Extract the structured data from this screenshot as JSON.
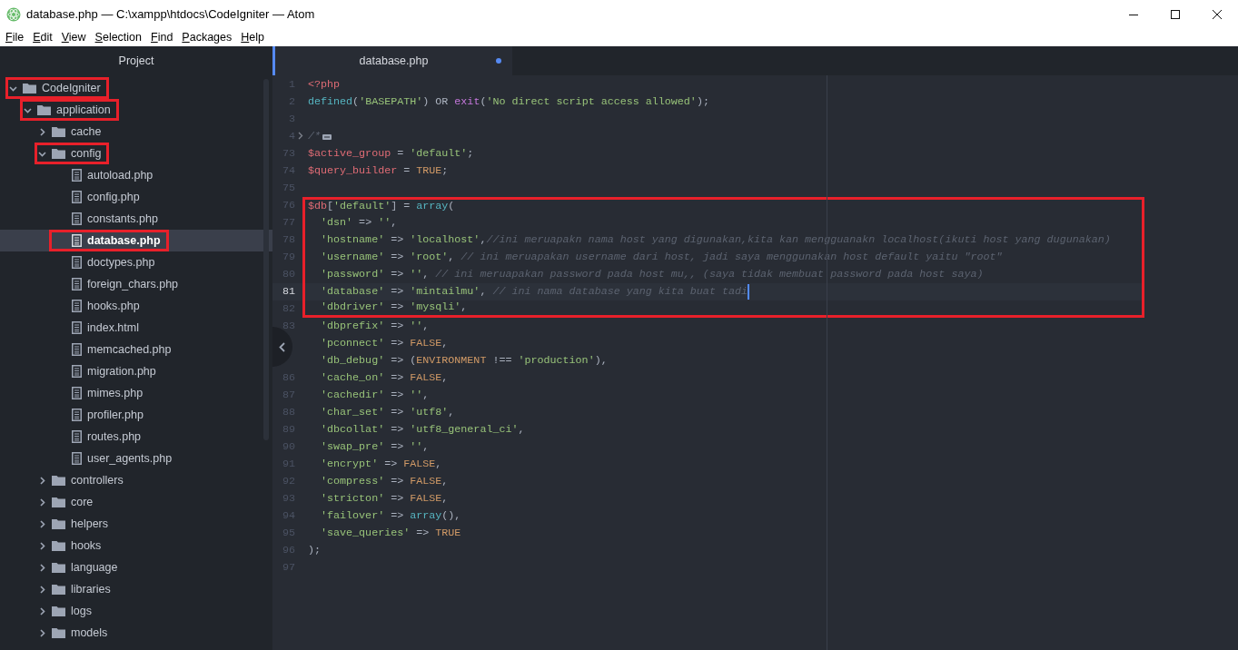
{
  "window": {
    "title": "database.php — C:\\xampp\\htdocs\\CodeIgniter — Atom"
  },
  "menu": [
    "File",
    "Edit",
    "View",
    "Selection",
    "Find",
    "Packages",
    "Help"
  ],
  "sidebar": {
    "title": "Project",
    "tree": [
      {
        "name": "CodeIgniter",
        "kind": "folder",
        "expanded": true,
        "boxed": true,
        "selected": false,
        "children": [
          {
            "name": "application",
            "kind": "folder",
            "expanded": true,
            "boxed": true,
            "selected": false,
            "children": [
              {
                "name": "cache",
                "kind": "folder",
                "expanded": false,
                "boxed": false,
                "selected": false
              },
              {
                "name": "config",
                "kind": "folder",
                "expanded": true,
                "boxed": true,
                "selected": false,
                "children": [
                  {
                    "name": "autoload.php",
                    "kind": "file",
                    "boxed": false,
                    "selected": false
                  },
                  {
                    "name": "config.php",
                    "kind": "file",
                    "boxed": false,
                    "selected": false
                  },
                  {
                    "name": "constants.php",
                    "kind": "file",
                    "boxed": false,
                    "selected": false
                  },
                  {
                    "name": "database.php",
                    "kind": "file",
                    "boxed": true,
                    "selected": true
                  },
                  {
                    "name": "doctypes.php",
                    "kind": "file",
                    "boxed": false,
                    "selected": false
                  },
                  {
                    "name": "foreign_chars.php",
                    "kind": "file",
                    "boxed": false,
                    "selected": false
                  },
                  {
                    "name": "hooks.php",
                    "kind": "file",
                    "boxed": false,
                    "selected": false
                  },
                  {
                    "name": "index.html",
                    "kind": "file",
                    "boxed": false,
                    "selected": false
                  },
                  {
                    "name": "memcached.php",
                    "kind": "file",
                    "boxed": false,
                    "selected": false
                  },
                  {
                    "name": "migration.php",
                    "kind": "file",
                    "boxed": false,
                    "selected": false
                  },
                  {
                    "name": "mimes.php",
                    "kind": "file",
                    "boxed": false,
                    "selected": false
                  },
                  {
                    "name": "profiler.php",
                    "kind": "file",
                    "boxed": false,
                    "selected": false
                  },
                  {
                    "name": "routes.php",
                    "kind": "file",
                    "boxed": false,
                    "selected": false
                  },
                  {
                    "name": "user_agents.php",
                    "kind": "file",
                    "boxed": false,
                    "selected": false
                  }
                ]
              },
              {
                "name": "controllers",
                "kind": "folder",
                "expanded": false,
                "boxed": false,
                "selected": false
              },
              {
                "name": "core",
                "kind": "folder",
                "expanded": false,
                "boxed": false,
                "selected": false
              },
              {
                "name": "helpers",
                "kind": "folder",
                "expanded": false,
                "boxed": false,
                "selected": false
              },
              {
                "name": "hooks",
                "kind": "folder",
                "expanded": false,
                "boxed": false,
                "selected": false
              },
              {
                "name": "language",
                "kind": "folder",
                "expanded": false,
                "boxed": false,
                "selected": false
              },
              {
                "name": "libraries",
                "kind": "folder",
                "expanded": false,
                "boxed": false,
                "selected": false
              },
              {
                "name": "logs",
                "kind": "folder",
                "expanded": false,
                "boxed": false,
                "selected": false
              },
              {
                "name": "models",
                "kind": "folder",
                "expanded": false,
                "boxed": false,
                "selected": false
              }
            ]
          }
        ]
      }
    ]
  },
  "tabs": [
    {
      "label": "database.php",
      "selected": true,
      "modified": true
    }
  ],
  "editor": {
    "lines": [
      {
        "number": "1",
        "tokens": [
          {
            "kind": "tag",
            "text": "<?php"
          }
        ]
      },
      {
        "number": "2",
        "tokens": [
          {
            "kind": "func",
            "text": "defined"
          },
          {
            "kind": "plain",
            "text": "("
          },
          {
            "kind": "string",
            "text": "'BASEPATH'"
          },
          {
            "kind": "plain",
            "text": ") OR "
          },
          {
            "kind": "keyword",
            "text": "exit"
          },
          {
            "kind": "plain",
            "text": "("
          },
          {
            "kind": "string",
            "text": "'No direct script access allowed'"
          },
          {
            "kind": "plain",
            "text": ");"
          }
        ]
      },
      {
        "number": "3"
      },
      {
        "number": "4",
        "folded": true,
        "tokens": [
          {
            "kind": "comment",
            "text": "/*"
          }
        ]
      },
      {
        "number": "73",
        "tokens": [
          {
            "kind": "variable",
            "text": "$active_group"
          },
          {
            "kind": "plain",
            "text": " = "
          },
          {
            "kind": "string",
            "text": "'default'"
          },
          {
            "kind": "plain",
            "text": ";"
          }
        ]
      },
      {
        "number": "74",
        "tokens": [
          {
            "kind": "variable",
            "text": "$query_builder"
          },
          {
            "kind": "plain",
            "text": " = "
          },
          {
            "kind": "constant",
            "text": "TRUE"
          },
          {
            "kind": "plain",
            "text": ";"
          }
        ]
      },
      {
        "number": "75"
      },
      {
        "number": "76",
        "boxed": true,
        "tokens": [
          {
            "kind": "variable",
            "text": "$db"
          },
          {
            "kind": "plain",
            "text": "["
          },
          {
            "kind": "string",
            "text": "'default'"
          },
          {
            "kind": "plain",
            "text": "] = "
          },
          {
            "kind": "func",
            "text": "array"
          },
          {
            "kind": "plain",
            "text": "("
          }
        ]
      },
      {
        "number": "77",
        "boxed": true,
        "tokens": [
          {
            "kind": "string",
            "text": "  'dsn'"
          },
          {
            "kind": "plain",
            "text": " => "
          },
          {
            "kind": "string",
            "text": "''"
          },
          {
            "kind": "plain",
            "text": ","
          }
        ]
      },
      {
        "number": "78",
        "boxed": true,
        "tokens": [
          {
            "kind": "string",
            "text": "  'hostname'"
          },
          {
            "kind": "plain",
            "text": " => "
          },
          {
            "kind": "string",
            "text": "'localhost'"
          },
          {
            "kind": "plain",
            "text": ","
          },
          {
            "kind": "comment",
            "text": "//ini meruapakn nama host yang digunakan,kita kan mengguanakn localhost(ikuti host yang dugunakan)"
          }
        ]
      },
      {
        "number": "79",
        "boxed": true,
        "tokens": [
          {
            "kind": "string",
            "text": "  'username'"
          },
          {
            "kind": "plain",
            "text": " => "
          },
          {
            "kind": "string",
            "text": "'root'"
          },
          {
            "kind": "plain",
            "text": ", "
          },
          {
            "kind": "comment",
            "text": "// ini meruapakan username dari host, jadi saya menggunakan host default yaitu \"root\""
          }
        ]
      },
      {
        "number": "80",
        "boxed": true,
        "tokens": [
          {
            "kind": "string",
            "text": "  'password'"
          },
          {
            "kind": "plain",
            "text": " => "
          },
          {
            "kind": "string",
            "text": "''"
          },
          {
            "kind": "plain",
            "text": ", "
          },
          {
            "kind": "comment",
            "text": "// ini meruapakan password pada host mu,, (saya tidak membuat password pada host saya)"
          }
        ]
      },
      {
        "number": "81",
        "boxed": true,
        "current": true,
        "tokens": [
          {
            "kind": "string",
            "text": "  'database'"
          },
          {
            "kind": "plain",
            "text": " => "
          },
          {
            "kind": "string",
            "text": "'mintailmu'"
          },
          {
            "kind": "plain",
            "text": ", "
          },
          {
            "kind": "comment",
            "text": "// ini nama database yang kita buat tadi"
          }
        ]
      },
      {
        "number": "82",
        "boxed": true,
        "tokens": [
          {
            "kind": "string",
            "text": "  'dbdriver'"
          },
          {
            "kind": "plain",
            "text": " => "
          },
          {
            "kind": "string",
            "text": "'mysqli'"
          },
          {
            "kind": "plain",
            "text": ","
          }
        ]
      },
      {
        "number": "83",
        "tokens": [
          {
            "kind": "string",
            "text": "  'dbprefix'"
          },
          {
            "kind": "plain",
            "text": " => "
          },
          {
            "kind": "string",
            "text": "''"
          },
          {
            "kind": "plain",
            "text": ","
          }
        ]
      },
      {
        "tokens": [
          {
            "kind": "string",
            "text": "  'pconnect'"
          },
          {
            "kind": "plain",
            "text": " => "
          },
          {
            "kind": "constant",
            "text": "FALSE"
          },
          {
            "kind": "plain",
            "text": ","
          }
        ]
      },
      {
        "tokens": [
          {
            "kind": "string",
            "text": "  'db_debug'"
          },
          {
            "kind": "plain",
            "text": " => ("
          },
          {
            "kind": "constant",
            "text": "ENVIRONMENT"
          },
          {
            "kind": "plain",
            "text": " !== "
          },
          {
            "kind": "string",
            "text": "'production'"
          },
          {
            "kind": "plain",
            "text": "),"
          }
        ]
      },
      {
        "number": "86",
        "tokens": [
          {
            "kind": "string",
            "text": "  'cache_on'"
          },
          {
            "kind": "plain",
            "text": " => "
          },
          {
            "kind": "constant",
            "text": "FALSE"
          },
          {
            "kind": "plain",
            "text": ","
          }
        ]
      },
      {
        "number": "87",
        "tokens": [
          {
            "kind": "string",
            "text": "  'cachedir'"
          },
          {
            "kind": "plain",
            "text": " => "
          },
          {
            "kind": "string",
            "text": "''"
          },
          {
            "kind": "plain",
            "text": ","
          }
        ]
      },
      {
        "number": "88",
        "tokens": [
          {
            "kind": "string",
            "text": "  'char_set'"
          },
          {
            "kind": "plain",
            "text": " => "
          },
          {
            "kind": "string",
            "text": "'utf8'"
          },
          {
            "kind": "plain",
            "text": ","
          }
        ]
      },
      {
        "number": "89",
        "tokens": [
          {
            "kind": "string",
            "text": "  'dbcollat'"
          },
          {
            "kind": "plain",
            "text": " => "
          },
          {
            "kind": "string",
            "text": "'utf8_general_ci'"
          },
          {
            "kind": "plain",
            "text": ","
          }
        ]
      },
      {
        "number": "90",
        "tokens": [
          {
            "kind": "string",
            "text": "  'swap_pre'"
          },
          {
            "kind": "plain",
            "text": " => "
          },
          {
            "kind": "string",
            "text": "''"
          },
          {
            "kind": "plain",
            "text": ","
          }
        ]
      },
      {
        "number": "91",
        "tokens": [
          {
            "kind": "string",
            "text": "  'encrypt'"
          },
          {
            "kind": "plain",
            "text": " => "
          },
          {
            "kind": "constant",
            "text": "FALSE"
          },
          {
            "kind": "plain",
            "text": ","
          }
        ]
      },
      {
        "number": "92",
        "tokens": [
          {
            "kind": "string",
            "text": "  'compress'"
          },
          {
            "kind": "plain",
            "text": " => "
          },
          {
            "kind": "constant",
            "text": "FALSE"
          },
          {
            "kind": "plain",
            "text": ","
          }
        ]
      },
      {
        "number": "93",
        "tokens": [
          {
            "kind": "string",
            "text": "  'stricton'"
          },
          {
            "kind": "plain",
            "text": " => "
          },
          {
            "kind": "constant",
            "text": "FALSE"
          },
          {
            "kind": "plain",
            "text": ","
          }
        ]
      },
      {
        "number": "94",
        "tokens": [
          {
            "kind": "string",
            "text": "  'failover'"
          },
          {
            "kind": "plain",
            "text": " => "
          },
          {
            "kind": "func",
            "text": "array"
          },
          {
            "kind": "plain",
            "text": "(),"
          }
        ]
      },
      {
        "number": "95",
        "tokens": [
          {
            "kind": "string",
            "text": "  'save_queries'"
          },
          {
            "kind": "plain",
            "text": " => "
          },
          {
            "kind": "constant",
            "text": "TRUE"
          }
        ]
      },
      {
        "number": "96",
        "tokens": [
          {
            "kind": "plain",
            "text": ");"
          }
        ]
      },
      {
        "number": "97"
      }
    ]
  }
}
